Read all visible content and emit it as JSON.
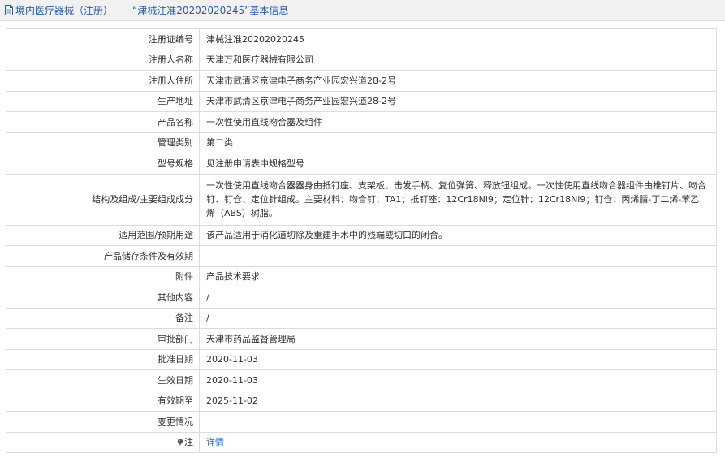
{
  "header": {
    "title": "境内医疗器械（注册）——“津械注准20202020245”基本信息"
  },
  "rows": [
    {
      "label": "注册证编号",
      "value": "津械注准20202020245"
    },
    {
      "label": "注册人名称",
      "value": "天津万和医疗器械有限公司"
    },
    {
      "label": "注册人住所",
      "value": "天津市武清区京津电子商务产业园宏兴道28-2号"
    },
    {
      "label": "生产地址",
      "value": "天津市武清区京津电子商务产业园宏兴道28-2号"
    },
    {
      "label": "产品名称",
      "value": "一次性使用直线吻合器及组件"
    },
    {
      "label": "管理类别",
      "value": "第二类"
    },
    {
      "label": "型号规格",
      "value": "见注册申请表中规格型号"
    },
    {
      "label": "结构及组成/主要组成成分",
      "value": "一次性使用直线吻合器器身由抵钉座、支架板、击发手柄、复位弹簧、释放钮组成。一次性使用直线吻合器组件由推钉片、吻合钉、钉仓、定位针组成。主要材料：吻合钉：TA1；抵钉座：12Cr18Ni9；定位针：12Cr18Ni9；钉仓：丙烯腈-丁二烯-苯乙烯（ABS）树脂。"
    },
    {
      "label": "适用范围/预期用途",
      "value": "该产品适用于消化道切除及重建手术中的残端或切口的闭合。"
    },
    {
      "label": "产品储存条件及有效期",
      "value": ""
    },
    {
      "label": "附件",
      "value": "产品技术要求"
    },
    {
      "label": "其他内容",
      "value": "/"
    },
    {
      "label": "备注",
      "value": "/"
    },
    {
      "label": "审批部门",
      "value": "天津市药品监督管理局"
    },
    {
      "label": "批准日期",
      "value": "2020-11-03"
    },
    {
      "label": "生效日期",
      "value": "2020-11-03"
    },
    {
      "label": "有效期至",
      "value": "2025-11-02"
    },
    {
      "label": "变更情况",
      "value": ""
    }
  ],
  "note": {
    "label": "注",
    "link_text": "详情",
    "icon": "pin-icon"
  },
  "colors": {
    "header_text": "#2a5db0",
    "link": "#2a6fc9",
    "border": "#dcdcdc"
  }
}
